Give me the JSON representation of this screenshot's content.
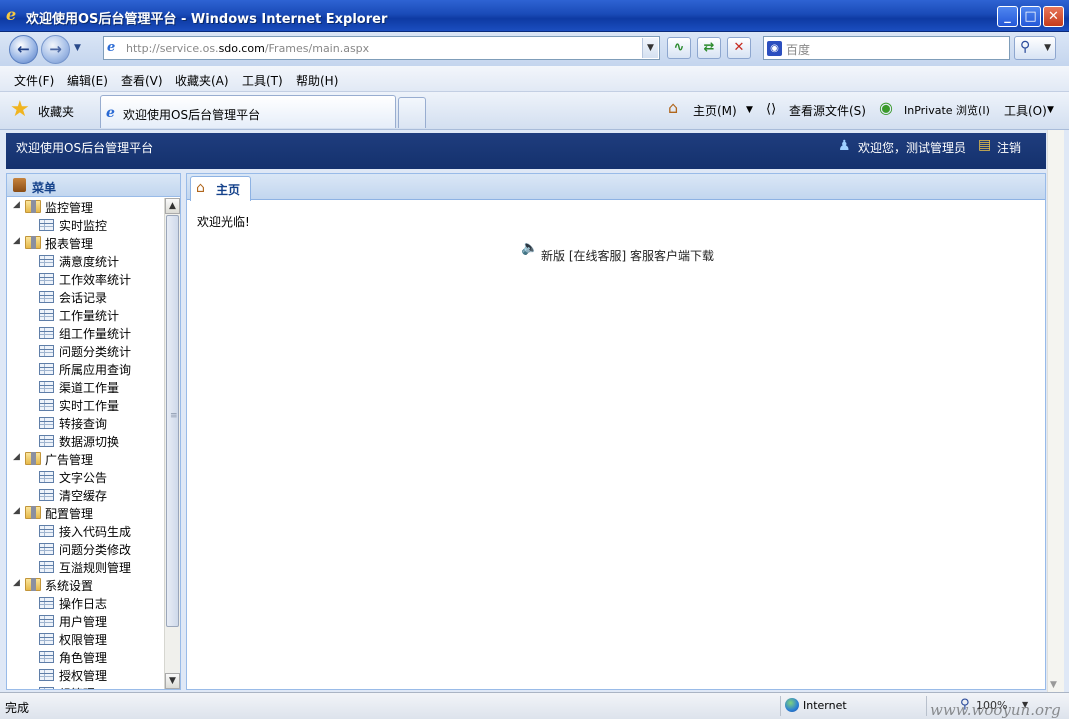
{
  "window": {
    "title": "欢迎使用OS后台管理平台 - Windows Internet Explorer",
    "ie_icon": "ie-logo-icon",
    "buttons": {
      "minimize": "_",
      "maximize": "□",
      "close": "✕"
    }
  },
  "address_bar": {
    "url_prefix": "http://service.os.",
    "url_domain": "sdo.com",
    "url_path": "/Frames/main.aspx",
    "search_placeholder": "百度"
  },
  "menu_bar": {
    "items": [
      "文件(F)",
      "编辑(E)",
      "查看(V)",
      "收藏夹(A)",
      "工具(T)",
      "帮助(H)"
    ]
  },
  "favorites_bar": {
    "favorites_label": "收藏夹",
    "active_tab": "欢迎使用OS后台管理平台",
    "commands": {
      "home": "主页(M)",
      "view_source": "查看源文件(S)",
      "inprivate": "InPrivate 浏览(I)",
      "tools": "工具(O)"
    }
  },
  "app": {
    "header_title": "欢迎使用OS后台管理平台",
    "welcome_user": "欢迎您，测试管理员",
    "logout": "注销",
    "menu_title": "菜单",
    "tree": [
      {
        "label": "监控管理",
        "children": [
          "实时监控"
        ]
      },
      {
        "label": "报表管理",
        "children": [
          "满意度统计",
          "工作效率统计",
          "会话记录",
          "工作量统计",
          "组工作量统计",
          "问题分类统计",
          "所属应用查询",
          "渠道工作量",
          "实时工作量",
          "转接查询",
          "数据源切换"
        ]
      },
      {
        "label": "广告管理",
        "children": [
          "文字公告",
          "清空缓存"
        ]
      },
      {
        "label": "配置管理",
        "children": [
          "接入代码生成",
          "问题分类修改",
          "互溢规则管理"
        ]
      },
      {
        "label": "系统设置",
        "children": [
          "操作日志",
          "用户管理",
          "权限管理",
          "角色管理",
          "授权管理",
          "组管理"
        ]
      }
    ],
    "home_tab": "主页",
    "welcome_message": "欢迎光临!",
    "notice_prefix": "新版 ",
    "notice_link": "[在线客服]",
    "notice_suffix": " 客服客户端下载"
  },
  "status_bar": {
    "status": "完成",
    "zone": "Internet",
    "zoom": "100%",
    "watermark": "www.wooyun.org"
  },
  "colors": {
    "titlebar": "#1a4bb8",
    "app_header": "#1f3d7e",
    "panel_border": "#99bbe8",
    "panel_title": "#15428b"
  }
}
